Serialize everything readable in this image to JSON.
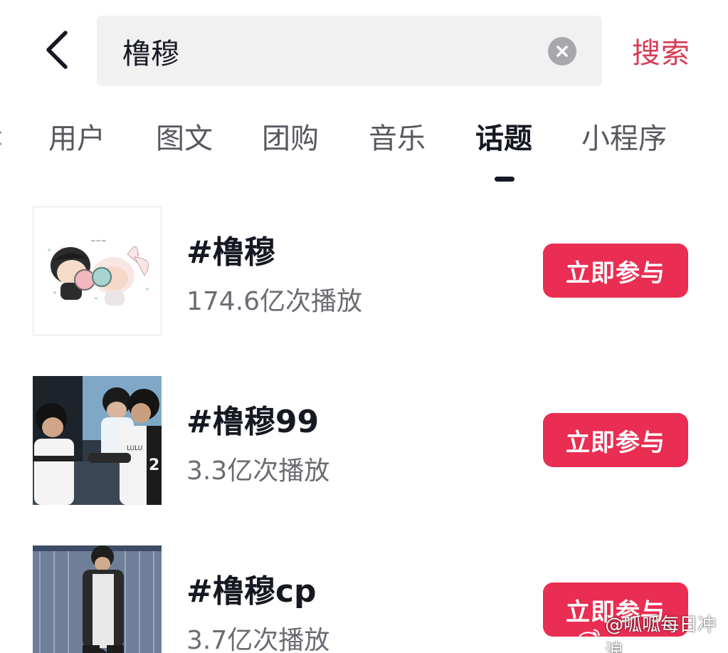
{
  "header": {
    "search_value": "橹穆",
    "search_button_label": "搜索"
  },
  "tabs": [
    {
      "label": "用户",
      "active": false
    },
    {
      "label": "图文",
      "active": false
    },
    {
      "label": "团购",
      "active": false
    },
    {
      "label": "音乐",
      "active": false
    },
    {
      "label": "话题",
      "active": true
    },
    {
      "label": "小程序",
      "active": false
    }
  ],
  "results": [
    {
      "title": "#橹穆",
      "plays": "174.6亿次播放",
      "action_label": "立即参与"
    },
    {
      "title": "#橹穆99",
      "plays": "3.3亿次播放",
      "action_label": "立即参与"
    },
    {
      "title": "#橹穆cp",
      "plays": "3.7亿次播放",
      "action_label": "立即参与"
    }
  ],
  "watermark": {
    "text": "@呱呱每日冲浪"
  },
  "colors": {
    "accent": "#ea2d52",
    "search_text": "#d83a54",
    "active_tab": "#161823",
    "muted": "#6b6b73",
    "search_bg": "#f1f1f2"
  },
  "icons": {
    "back": "chevron-left-icon",
    "clear": "clear-x-icon",
    "watermark": "weibo-logo-icon"
  }
}
